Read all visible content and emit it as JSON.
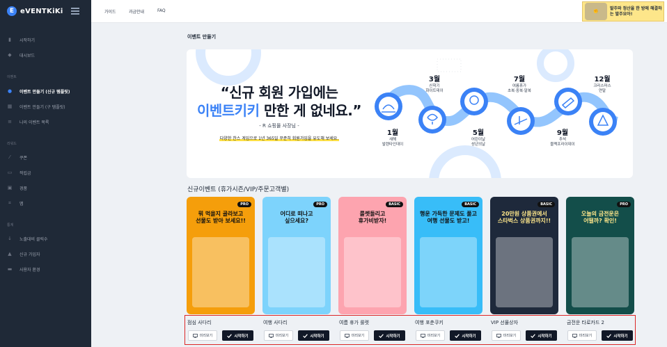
{
  "app": {
    "logo_text": "eVENTKiKi"
  },
  "sidebar": {
    "items": [
      {
        "label": "시작하기",
        "icon": "bars-icon"
      },
      {
        "label": "대시보드",
        "icon": "diamond-icon"
      },
      {
        "label": "이벤트 만들기 (신규 템플릿)",
        "icon": "plus-circle-icon",
        "active": true
      },
      {
        "label": "이벤트 만들기 (구 템플릿)",
        "icon": "grid-icon"
      },
      {
        "label": "나의 이벤트 목록",
        "icon": "list-icon"
      },
      {
        "label": "쿠폰",
        "icon": "tag-icon"
      },
      {
        "label": "적립금",
        "icon": "wallet-icon"
      },
      {
        "label": "경품",
        "icon": "gift-icon"
      },
      {
        "label": "맵",
        "icon": "map-icon"
      },
      {
        "label": "노출대비 클릭수",
        "icon": "pin-icon"
      },
      {
        "label": "신규 가입자",
        "icon": "user-icon"
      },
      {
        "label": "사용자 환경",
        "icon": "monitor-icon"
      }
    ],
    "sections": [
      "이벤트",
      "리워드",
      "통계"
    ]
  },
  "topbar": {
    "links": [
      "가이드",
      "과금안내",
      "FAQ"
    ],
    "banner_text": "발주와 정산을 한 방에 해결하는 발주요아!"
  },
  "page": {
    "title": "이벤트 만들기"
  },
  "hero": {
    "quote_line1": "“신규 회원 가입에는",
    "quote_line2_blue": "이벤트키키",
    "quote_line2_rest": " 만한 게 없네요.”",
    "author": "- R 쇼핑몰 사장님 -",
    "desc": "다양한 찬스 게임으로 1년 365일 꾸준히 회원가입을 유도해 보세요.",
    "months": [
      {
        "month": "1월",
        "label": "새해\n발렌타인데이"
      },
      {
        "month": "3월",
        "label": "신학기\n화이트데이"
      },
      {
        "month": "5월",
        "label": "어린이날\n성년의날"
      },
      {
        "month": "7월",
        "label": "여름휴가\n초복·중복·말복"
      },
      {
        "month": "9월",
        "label": "추석\n블랙프라이데이"
      },
      {
        "month": "12월",
        "label": "크리스마스\n연말"
      }
    ]
  },
  "section": {
    "title": "신규이벤트 (휴가시즌/VIP/주문고객별)"
  },
  "cards": [
    {
      "name": "점심 사다리",
      "badge": "PRO",
      "art_title": "뭐 먹을지 골라보고\n선물도 받아 보세요!!",
      "art_sub": "",
      "bg": "#f59e0b"
    },
    {
      "name": "여행 사다리",
      "badge": "PRO",
      "art_title": "어디로 떠나고\n싶으세요?",
      "art_sub": "",
      "bg": "#7dd3fc"
    },
    {
      "name": "여름 휴가 룰렛",
      "badge": "BASIC",
      "art_title": "룰렛돌리고\n휴가비받자!",
      "art_sub": "",
      "bg": "#fda4af"
    },
    {
      "name": "여행 포춘쿠키",
      "badge": "BASIC",
      "art_title": "행운 가득한 문제도 풀고\n여행 선물도 받고!",
      "art_sub": "",
      "bg": "#38bdf8"
    },
    {
      "name": "VIP 선물상자",
      "badge": "BASIC",
      "art_title": "20만원 상품권에서\n스타벅스 상품권까지!!",
      "art_sub": "",
      "bg": "#1e293b"
    },
    {
      "name": "금전운 타로카드 2",
      "badge": "PRO",
      "art_title": "오늘의 금전운은\n어떨까? 확인!",
      "art_sub": "",
      "bg": "#134e4a"
    }
  ],
  "buttons": {
    "preview": "미리보기",
    "start": "시작하기"
  },
  "colors": {
    "accent": "#3b82f6",
    "sidebar": "#1f2937",
    "selected_outline": "#dc2626"
  }
}
